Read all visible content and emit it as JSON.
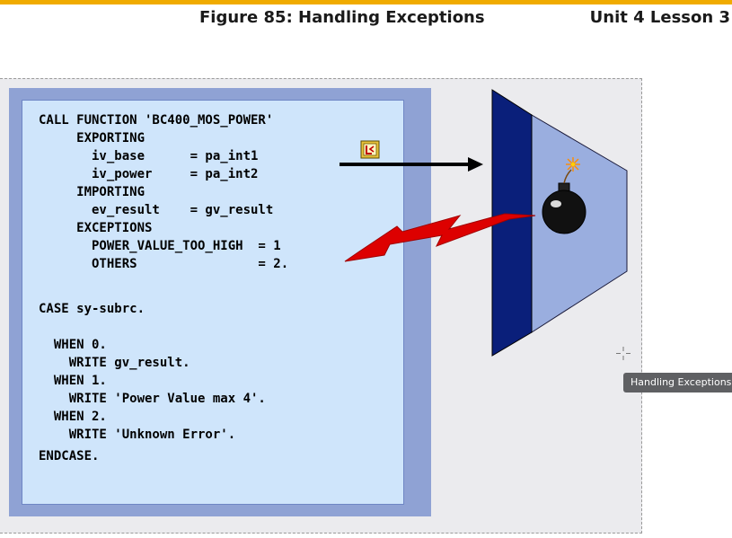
{
  "header": {
    "figure_title": "Figure 85: Handling Exceptions",
    "unit_label": "Unit 4 Lesson 3",
    "accent_color": "#f0ab00"
  },
  "code": {
    "lines": [
      "CALL FUNCTION 'BC400_MOS_POWER'",
      "     EXPORTING",
      "       iv_base      = pa_int1",
      "       iv_power     = pa_int2",
      "     IMPORTING",
      "       ev_result    = gv_result",
      "     EXCEPTIONS",
      "       POWER_VALUE_TOO_HIGH  = 1",
      "       OTHERS                = 2.",
      "CASE sy-subrc.",
      "  WHEN 0.",
      "    WRITE gv_result.",
      "  WHEN 1.",
      "    WRITE 'Power Value max 4'.",
      "  WHEN 2.",
      "    WRITE 'Unknown Error'.",
      "ENDCASE."
    ],
    "panel_color": "#cfe5fb",
    "shadow_color": "#8fa2d4"
  },
  "graphic": {
    "icons": [
      "sap-function-module-icon",
      "call-arrow-icon",
      "lightning-arrow-icon",
      "bomb-icon",
      "function-module-shape-icon"
    ],
    "colors": {
      "dark_blue": "#0a1f7a",
      "light_blue": "#9aaedf",
      "red": "#dd0000"
    }
  },
  "tooltip": {
    "text": "Handling Exceptions"
  }
}
